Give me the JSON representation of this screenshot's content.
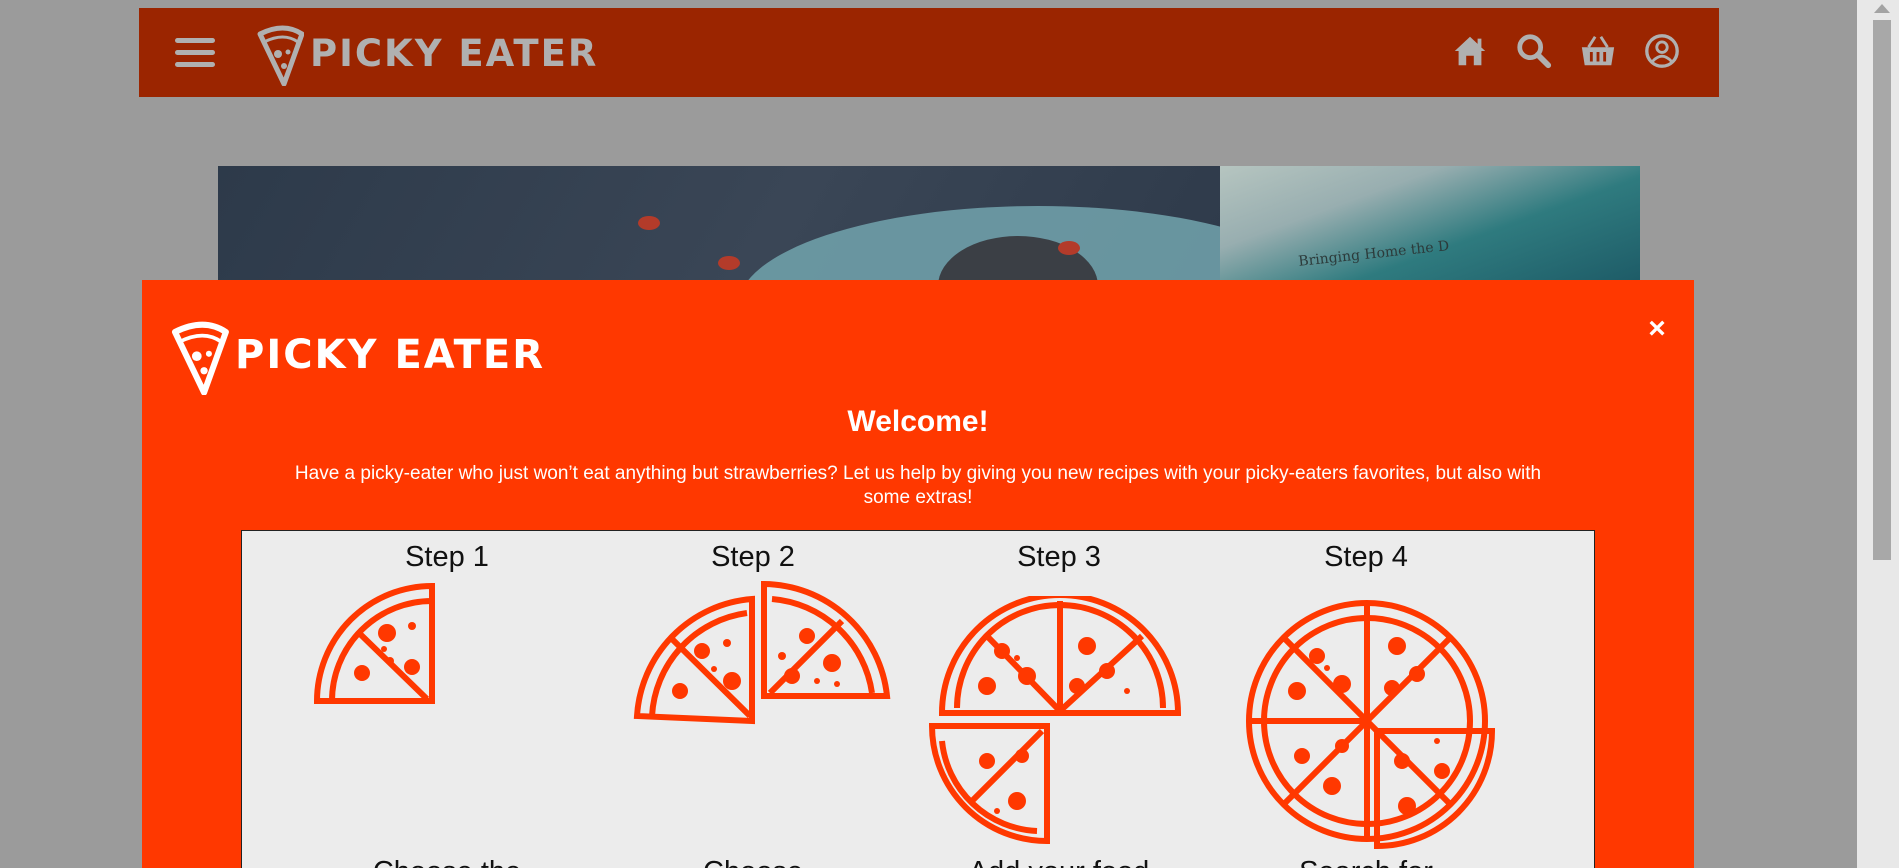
{
  "nav": {
    "brand": "PICKY EATER",
    "icons": [
      "menu-icon",
      "home-icon",
      "search-icon",
      "basket-icon",
      "account-icon"
    ]
  },
  "hero": {
    "book_spine_text": "Bringing Home the D"
  },
  "modal": {
    "brand": "PICKY EATER",
    "close_label": "×",
    "title": "Welcome!",
    "intro": "Have a picky-eater who just won’t eat anything but strawberries? Let us help by giving you new recipes with your picky-eaters favorites, but also with some extras!",
    "steps": [
      {
        "title": "Step 1",
        "caption": "Choose the"
      },
      {
        "title": "Step 2",
        "caption": "Choose"
      },
      {
        "title": "Step 3",
        "caption": "Add your food"
      },
      {
        "title": "Step 4",
        "caption": "Search for"
      }
    ]
  },
  "colors": {
    "nav_bg": "#9b2500",
    "modal_bg": "#ff3800",
    "overlay": "#9b9b9b",
    "steps_bg": "#ececec",
    "pizza": "#ff3800"
  }
}
